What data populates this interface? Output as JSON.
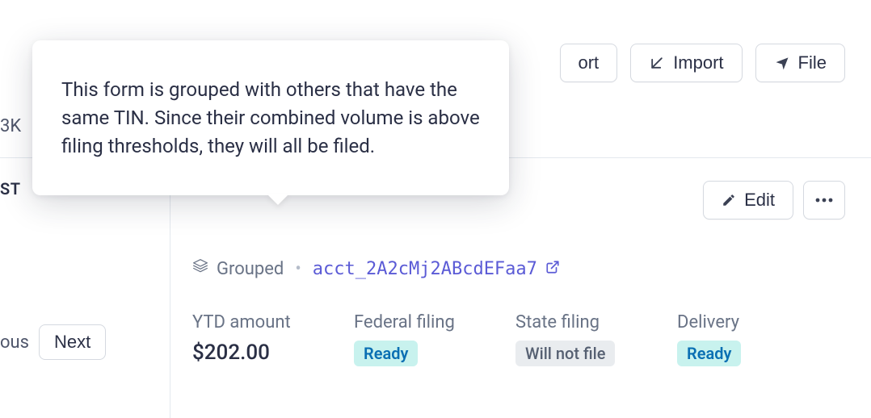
{
  "top_actions": {
    "export_label": "ort",
    "import_label": "Import",
    "file_label": "File"
  },
  "tooltip_text": "This form is grouped with others that have the same TIN. Since their combined volume is above filing thresholds, they will all be filed.",
  "left": {
    "hint_3k": "3K",
    "hint_st": "ST",
    "hint_ous": "ous",
    "next_label": "Next"
  },
  "panel": {
    "edit_label": "Edit",
    "grouped_label": "Grouped",
    "account_id": "acct_2A2cMj2ABcdEFaa7",
    "stats": {
      "ytd": {
        "label": "YTD amount",
        "value": "$202.00"
      },
      "federal": {
        "label": "Federal filing",
        "badge": "Ready"
      },
      "state": {
        "label": "State filing",
        "badge": "Will not file"
      },
      "delivery": {
        "label": "Delivery",
        "badge": "Ready"
      }
    }
  }
}
